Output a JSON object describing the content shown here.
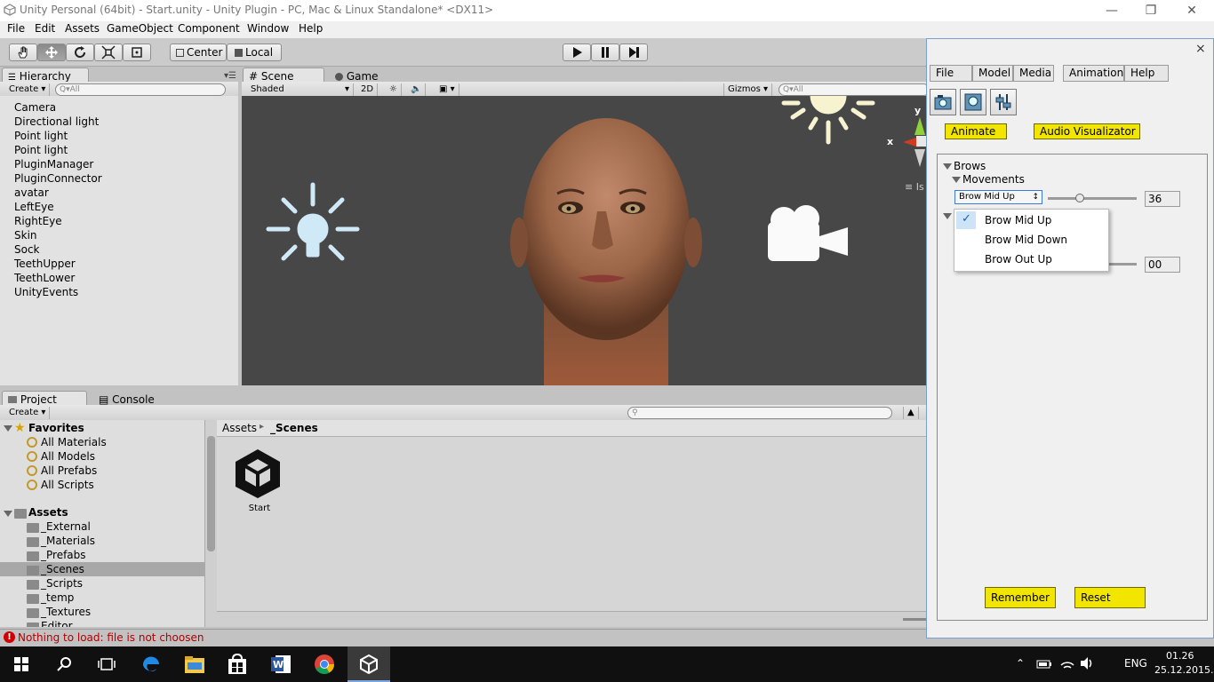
{
  "window": {
    "title": "Unity Personal (64bit) - Start.unity - Unity Plugin - PC, Mac & Linux Standalone* <DX11>",
    "controls": {
      "minimize": "—",
      "maximize": "❐",
      "close": "✕"
    }
  },
  "menu": [
    "File",
    "Edit",
    "Assets",
    "GameObject",
    "Component",
    "Window",
    "Help"
  ],
  "toolbar": {
    "pivot": "Center",
    "space": "Local",
    "tools": [
      "hand-icon",
      "move-icon",
      "rotate-icon",
      "scale-icon",
      "rect-tool-icon"
    ]
  },
  "hierarchy": {
    "tab": "Hierarchy",
    "create": "Create ▾",
    "search_placeholder": "Q▾All",
    "items": [
      "Camera",
      "Directional light",
      "Point light",
      "Point light",
      "PluginManager",
      "PluginConnector",
      "avatar",
      "LeftEye",
      "RightEye",
      "Skin",
      "Sock",
      "TeethUpper",
      "TeethLower",
      "UnityEvents"
    ]
  },
  "scene": {
    "tab_scene": "Scene",
    "tab_game": "Game",
    "shading": "Shaded",
    "mode_2d": "2D",
    "gizmos": "Gizmos ▾",
    "search_placeholder": "Q▾All",
    "axis_y": "y",
    "axis_x": "x",
    "iso_label": "Is"
  },
  "project": {
    "tab_project": "Project",
    "tab_console": "Console",
    "create": "Create ▾",
    "favorites_label": "Favorites",
    "favorites": [
      "All Materials",
      "All Models",
      "All Prefabs",
      "All Scripts"
    ],
    "assets_label": "Assets",
    "folders": [
      "_External",
      "_Materials",
      "_Prefabs",
      "_Scenes",
      "_Scripts",
      "_temp",
      "_Textures",
      "Editor"
    ],
    "selected_folder": "_Scenes",
    "breadcrumb_root": "Assets",
    "breadcrumb_sep": "▸",
    "breadcrumb_current": "_Scenes",
    "asset_name": "Start"
  },
  "status": {
    "message": "Nothing to load: file is not choosen",
    "icon_char": "!"
  },
  "plugin": {
    "close": "×",
    "menu": [
      "File",
      "Model",
      "Media",
      "Animation",
      "Help"
    ],
    "animate_button": "Animate",
    "audio_button": "Audio Visualizator",
    "section": "Brows",
    "subsection": "Movements",
    "selected_movement": "Brow Mid Up",
    "select_arrow": "↕",
    "slider_value": "36",
    "slider_fraction": 0.36,
    "second_value": "00",
    "remember_button": "Remember",
    "reset_button": "Reset",
    "dropdown_options": [
      "Brow Mid Up",
      "Brow Mid Down",
      "Brow Out Up"
    ],
    "check": "✓"
  },
  "taskbar": {
    "language": "ENG",
    "time": "01.26",
    "date": "25.12.2015."
  }
}
